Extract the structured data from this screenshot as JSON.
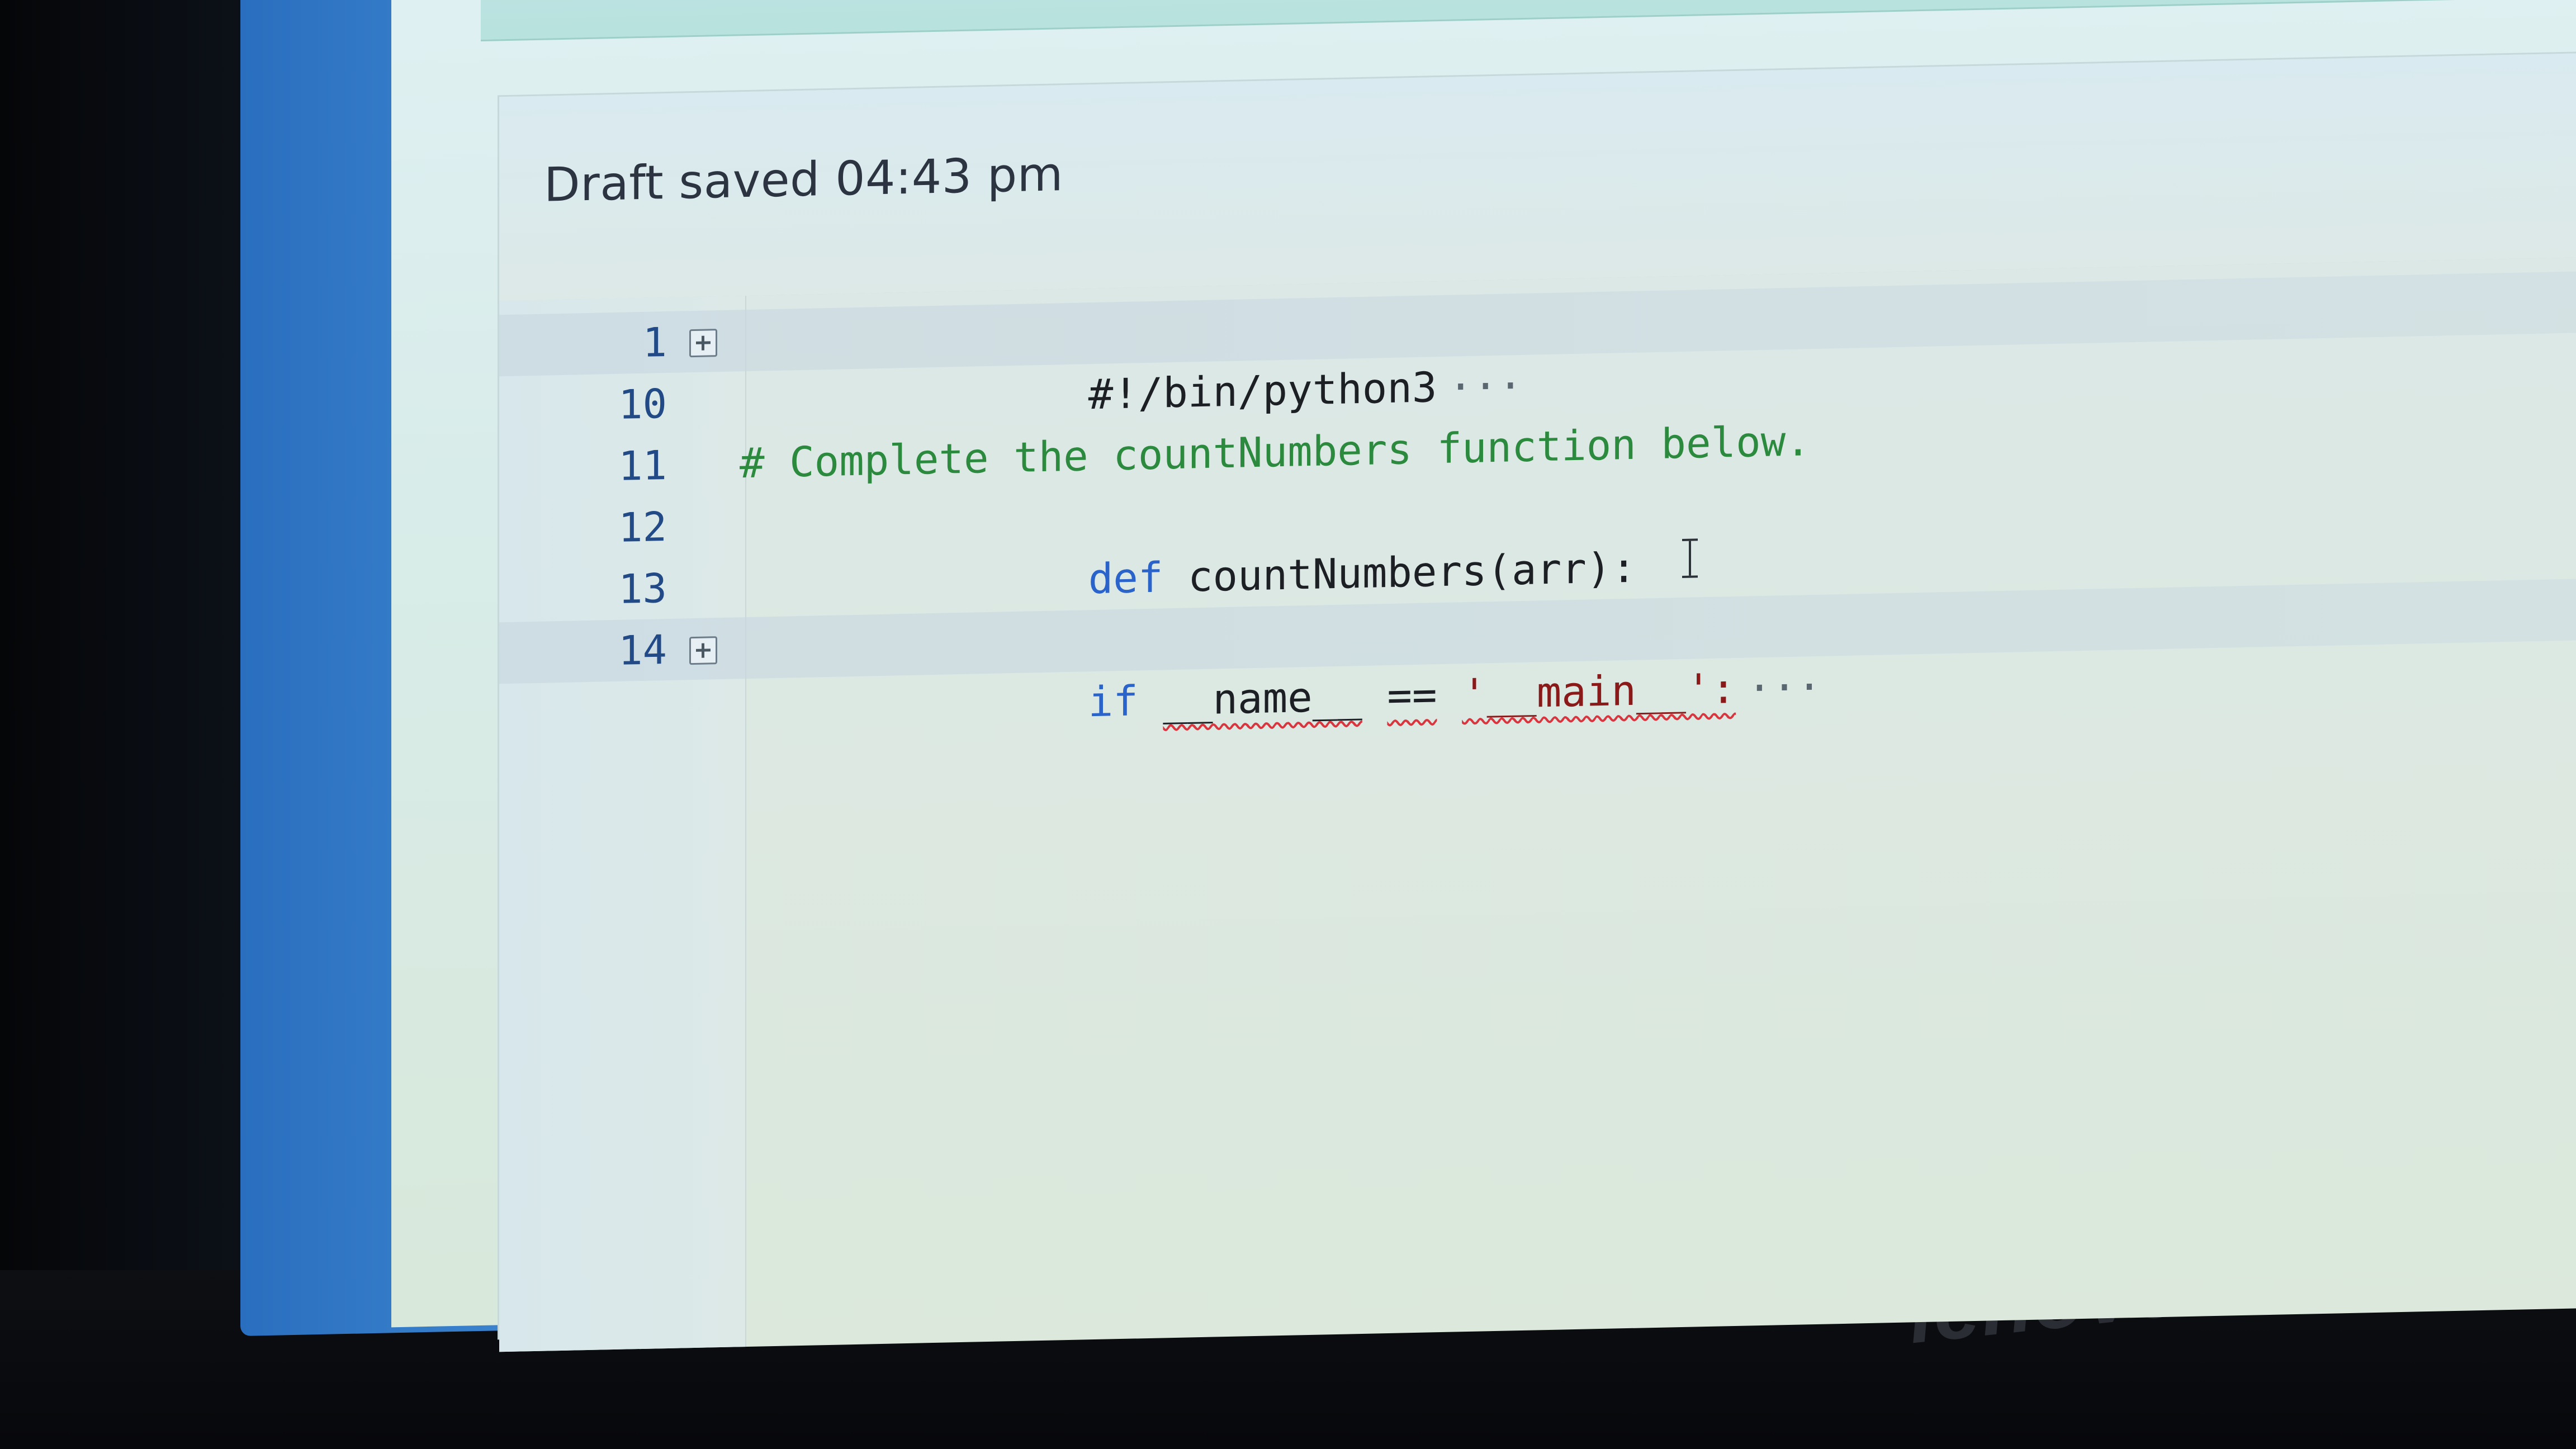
{
  "draft_status": "Draft saved 04:43 pm",
  "editor": {
    "lines": [
      {
        "number": "1",
        "text": "#!/bin/python3",
        "suffix": "···"
      },
      {
        "number": "10",
        "text": ""
      },
      {
        "number": "11",
        "text": "# Complete the countNumbers function below."
      },
      {
        "number": "12",
        "keyword": "def",
        "text": "countNumbers(arr):"
      },
      {
        "number": "13",
        "text": ""
      },
      {
        "number": "14",
        "keyword": "if",
        "part1": "__name__",
        "op": "==",
        "part2": "'__main__':",
        "suffix": "···"
      }
    ]
  },
  "brand": "lenovo",
  "icons": {
    "fold": "expand-plus-icon",
    "cursor": "text-cursor-icon"
  }
}
